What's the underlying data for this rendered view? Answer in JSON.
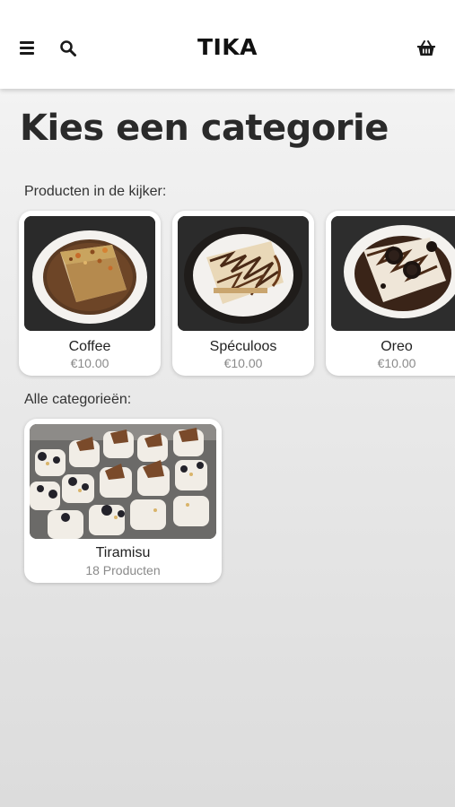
{
  "header": {
    "brand": "TIKA",
    "icons": [
      "menu-icon",
      "search-icon",
      "basket-icon"
    ]
  },
  "page": {
    "title": "Kies een categorie",
    "featured_label": "Producten in de kijker:",
    "categories_label": "Alle categorieën:"
  },
  "featured": [
    {
      "name": "Coffee",
      "price": "€10.00"
    },
    {
      "name": "Spéculoos",
      "price": "€10.00"
    },
    {
      "name": "Oreo",
      "price": "€10.00"
    }
  ],
  "categories": [
    {
      "name": "Tiramisu",
      "count": "18 Producten"
    }
  ],
  "colors": {
    "header_bg": "#ffffff",
    "text_dark": "#222222",
    "text_muted": "#8a8a8a",
    "card_bg": "#ffffff"
  }
}
